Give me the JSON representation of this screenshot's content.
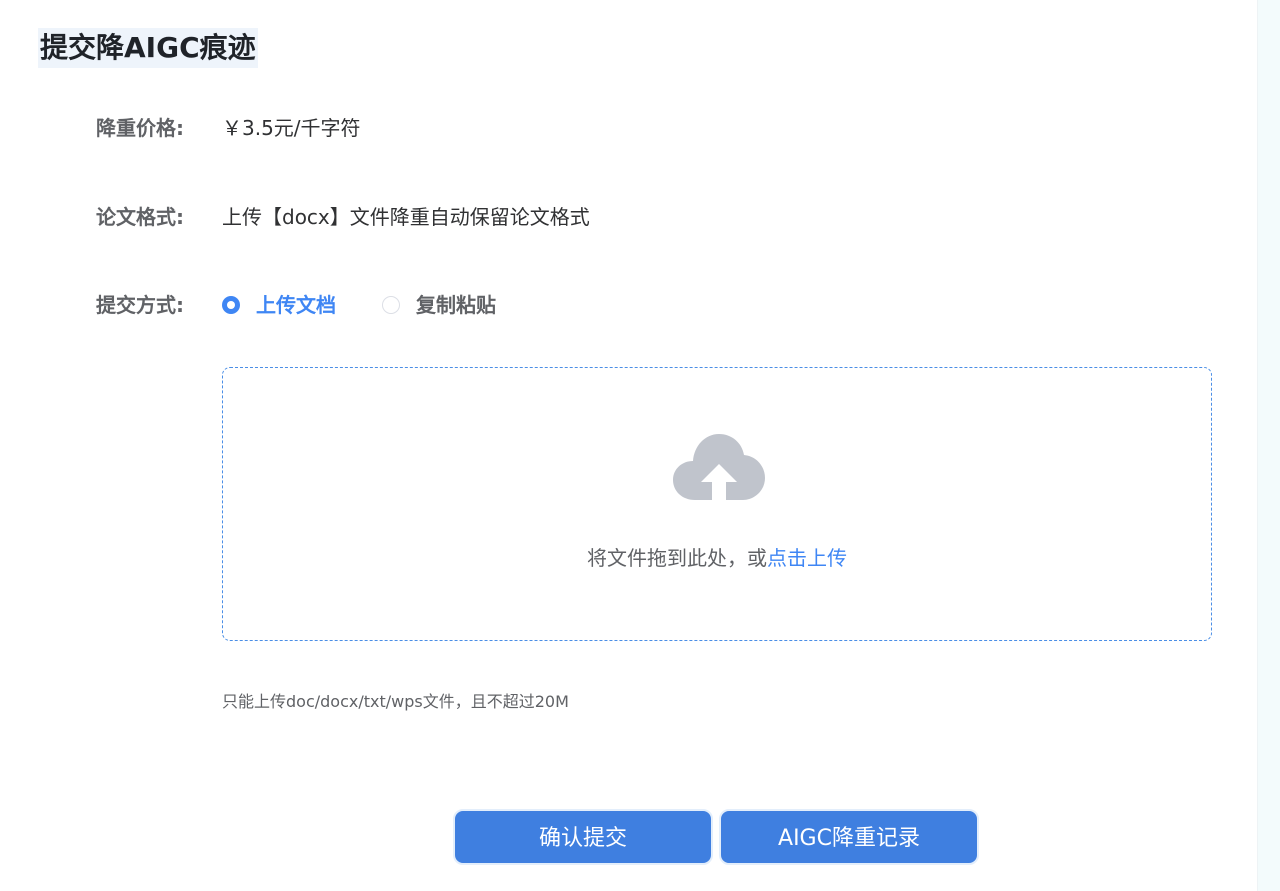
{
  "page": {
    "title": "提交降AIGC痕迹"
  },
  "form": {
    "price_label": "降重价格:",
    "price_value": "￥3.5元/千字符",
    "format_label": "论文格式:",
    "format_value": "上传【docx】文件降重自动保留论文格式",
    "method_label": "提交方式:",
    "method_options": [
      {
        "label": "上传文档",
        "selected": true
      },
      {
        "label": "复制粘贴",
        "selected": false
      }
    ]
  },
  "upload": {
    "icon": "cloud-upload-icon",
    "hint_text": "将文件拖到此处，或",
    "link_text": "点击上传",
    "tip": "只能上传doc/docx/txt/wps文件，且不超过20M"
  },
  "actions": {
    "confirm_label": "确认提交",
    "records_label": "AIGC降重记录"
  },
  "colors": {
    "accent": "#3f86f4",
    "button": "#3f7fe0",
    "icon_gray": "#c0c4cc"
  }
}
